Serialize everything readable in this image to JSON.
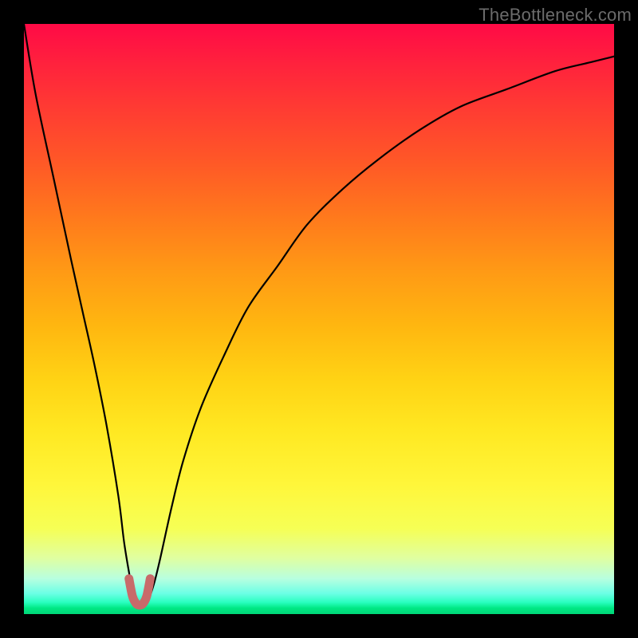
{
  "watermark": "TheBottleneck.com",
  "chart_data": {
    "type": "line",
    "title": "",
    "xlabel": "",
    "ylabel": "",
    "xlim": [
      0,
      100
    ],
    "ylim": [
      0,
      100
    ],
    "grid": false,
    "legend": false,
    "series": [
      {
        "name": "bottleneck-curve",
        "x": [
          0,
          2,
          5,
          8,
          10,
          12,
          14,
          16,
          17,
          18,
          18.7,
          19.3,
          20.2,
          21.1,
          22,
          23,
          25,
          27,
          30,
          34,
          38,
          43,
          48,
          54,
          60,
          67,
          74,
          82,
          90,
          96,
          100
        ],
        "values": [
          100,
          88,
          74,
          60,
          51,
          42,
          32,
          20,
          12,
          6,
          2.5,
          1.5,
          1.5,
          2.5,
          5,
          9,
          18,
          26,
          35,
          44,
          52,
          59,
          66,
          72,
          77,
          82,
          86,
          89,
          92,
          93.5,
          94.5
        ]
      }
    ],
    "notch": {
      "x": [
        17.8,
        18.4,
        19.0,
        19.6,
        20.2,
        20.8,
        21.4
      ],
      "y": [
        6.0,
        3.0,
        1.8,
        1.5,
        1.8,
        3.0,
        6.0
      ]
    },
    "colors": {
      "curve": "#000000",
      "notch": "#c86a6a"
    }
  }
}
